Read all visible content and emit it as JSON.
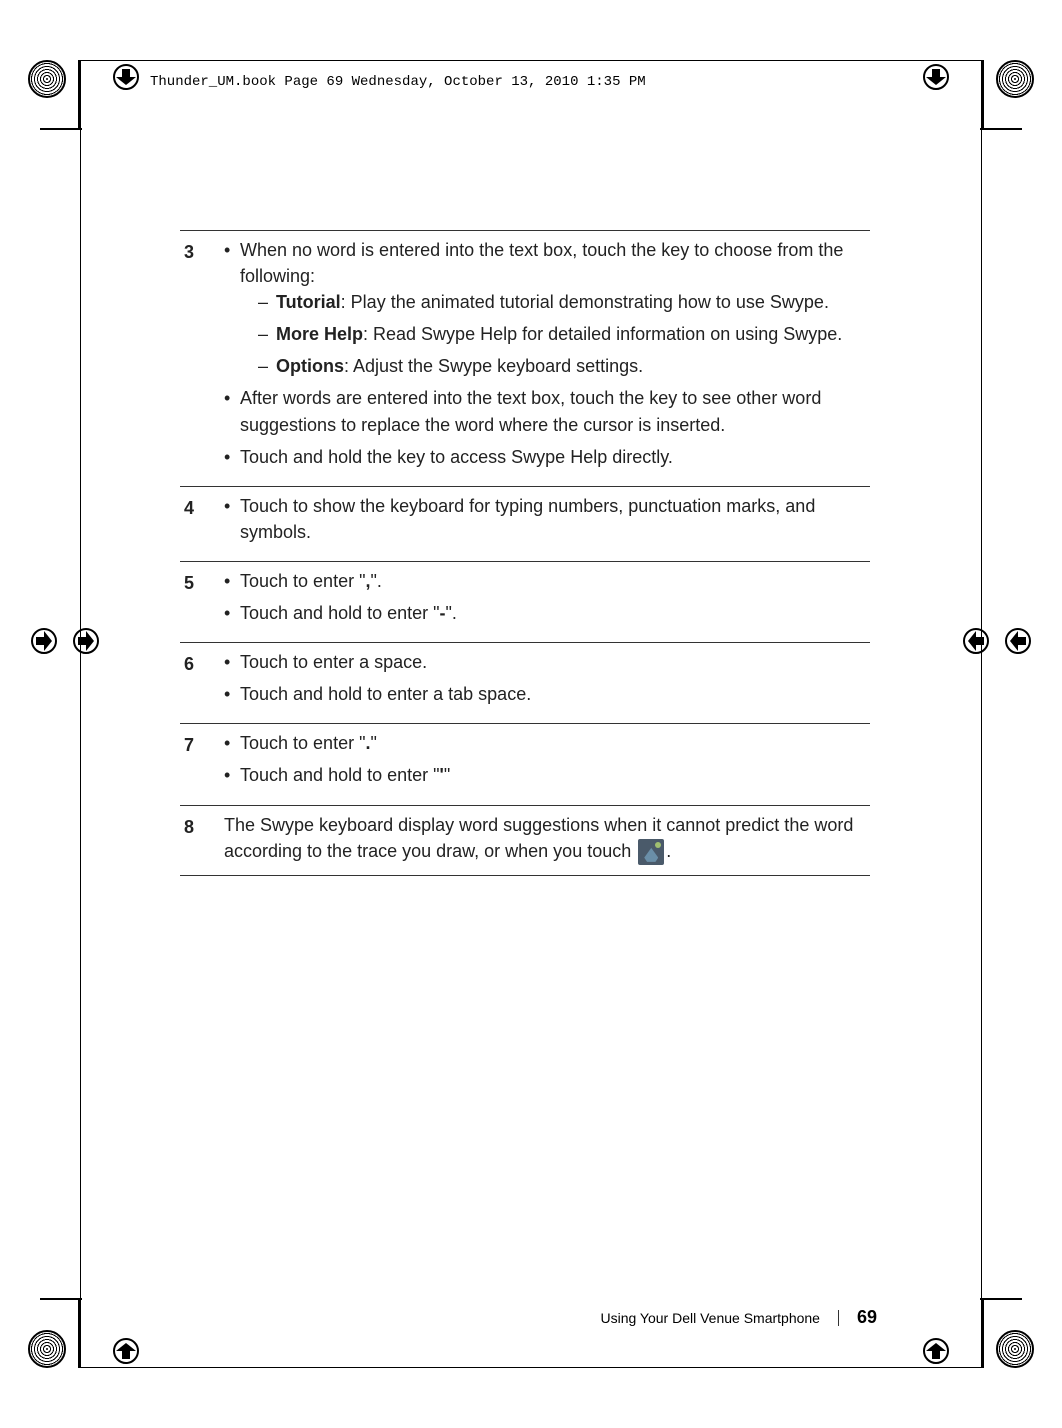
{
  "header": "Thunder_UM.book  Page 69  Wednesday, October 13, 2010  1:35 PM",
  "rows": {
    "r3": {
      "num": "3",
      "b1": "When no word is entered into the text box, touch the key to choose from the following:",
      "d1a": "Tutorial",
      "d1b": ": Play the animated tutorial demonstrating how to use Swype.",
      "d2a": "More Help",
      "d2b": ": Read Swype Help for detailed information on using Swype.",
      "d3a": "Options",
      "d3b": ": Adjust the Swype keyboard settings.",
      "b2": "After words are entered into the text box, touch the key to see other word suggestions to replace the word where the cursor is inserted.",
      "b3": "Touch and hold the key to access Swype Help directly."
    },
    "r4": {
      "num": "4",
      "b1": "Touch to show the keyboard for typing numbers, punctuation marks, and symbols."
    },
    "r5": {
      "num": "5",
      "b1a": "Touch to enter \"",
      "b1b": ",",
      "b1c": "\".",
      "b2a": "Touch and hold to enter \"",
      "b2b": "-",
      "b2c": "\"."
    },
    "r6": {
      "num": "6",
      "b1": "Touch to enter a space.",
      "b2": "Touch and hold to enter a tab space."
    },
    "r7": {
      "num": "7",
      "b1a": "Touch to enter \"",
      "b1b": ".",
      "b1c": "\"",
      "b2a": "Touch and hold to enter \"",
      "b2b": "'",
      "b2c": "\""
    },
    "r8": {
      "num": "8",
      "t1": "The Swype keyboard display word suggestions when it cannot predict the word according to the trace you draw, or when you touch ",
      "t2": "."
    }
  },
  "footer": {
    "title": "Using Your Dell Venue Smartphone",
    "page": "69"
  }
}
